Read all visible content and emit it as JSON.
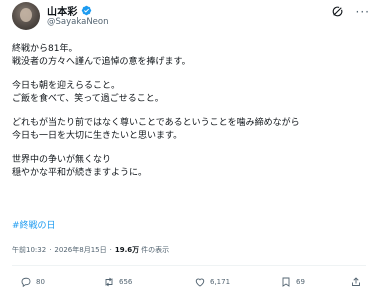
{
  "author": {
    "display_name": "山本彩",
    "handle": "@SayakaNeon",
    "verified_color": "#1d9bf0"
  },
  "tweet": {
    "lines": [
      "終戦から81年。",
      "戦没者の方々へ謹んで追悼の意を捧げます。",
      "",
      "今日も朝を迎えらること。",
      "ご飯を食べて、笑って過ごせること。",
      "",
      "どれもが当たり前ではなく尊いことであるということを噛み締めながら",
      "今日も一日を大切に生きたいと思います。",
      "",
      "世界中の争いが無くなり",
      "穏やかな平和が続きますように。"
    ],
    "hashtag": "#終戦の日"
  },
  "meta": {
    "time": "午前10:32",
    "date": "2026年8月15日",
    "views_count": "19.6万",
    "views_label": "件の表示"
  },
  "actions": {
    "replies": "80",
    "retweets": "656",
    "likes": "6,171",
    "bookmarks": "69"
  },
  "colors": {
    "link": "#1d9bf0",
    "muted": "#536471",
    "text": "#0f1419"
  }
}
